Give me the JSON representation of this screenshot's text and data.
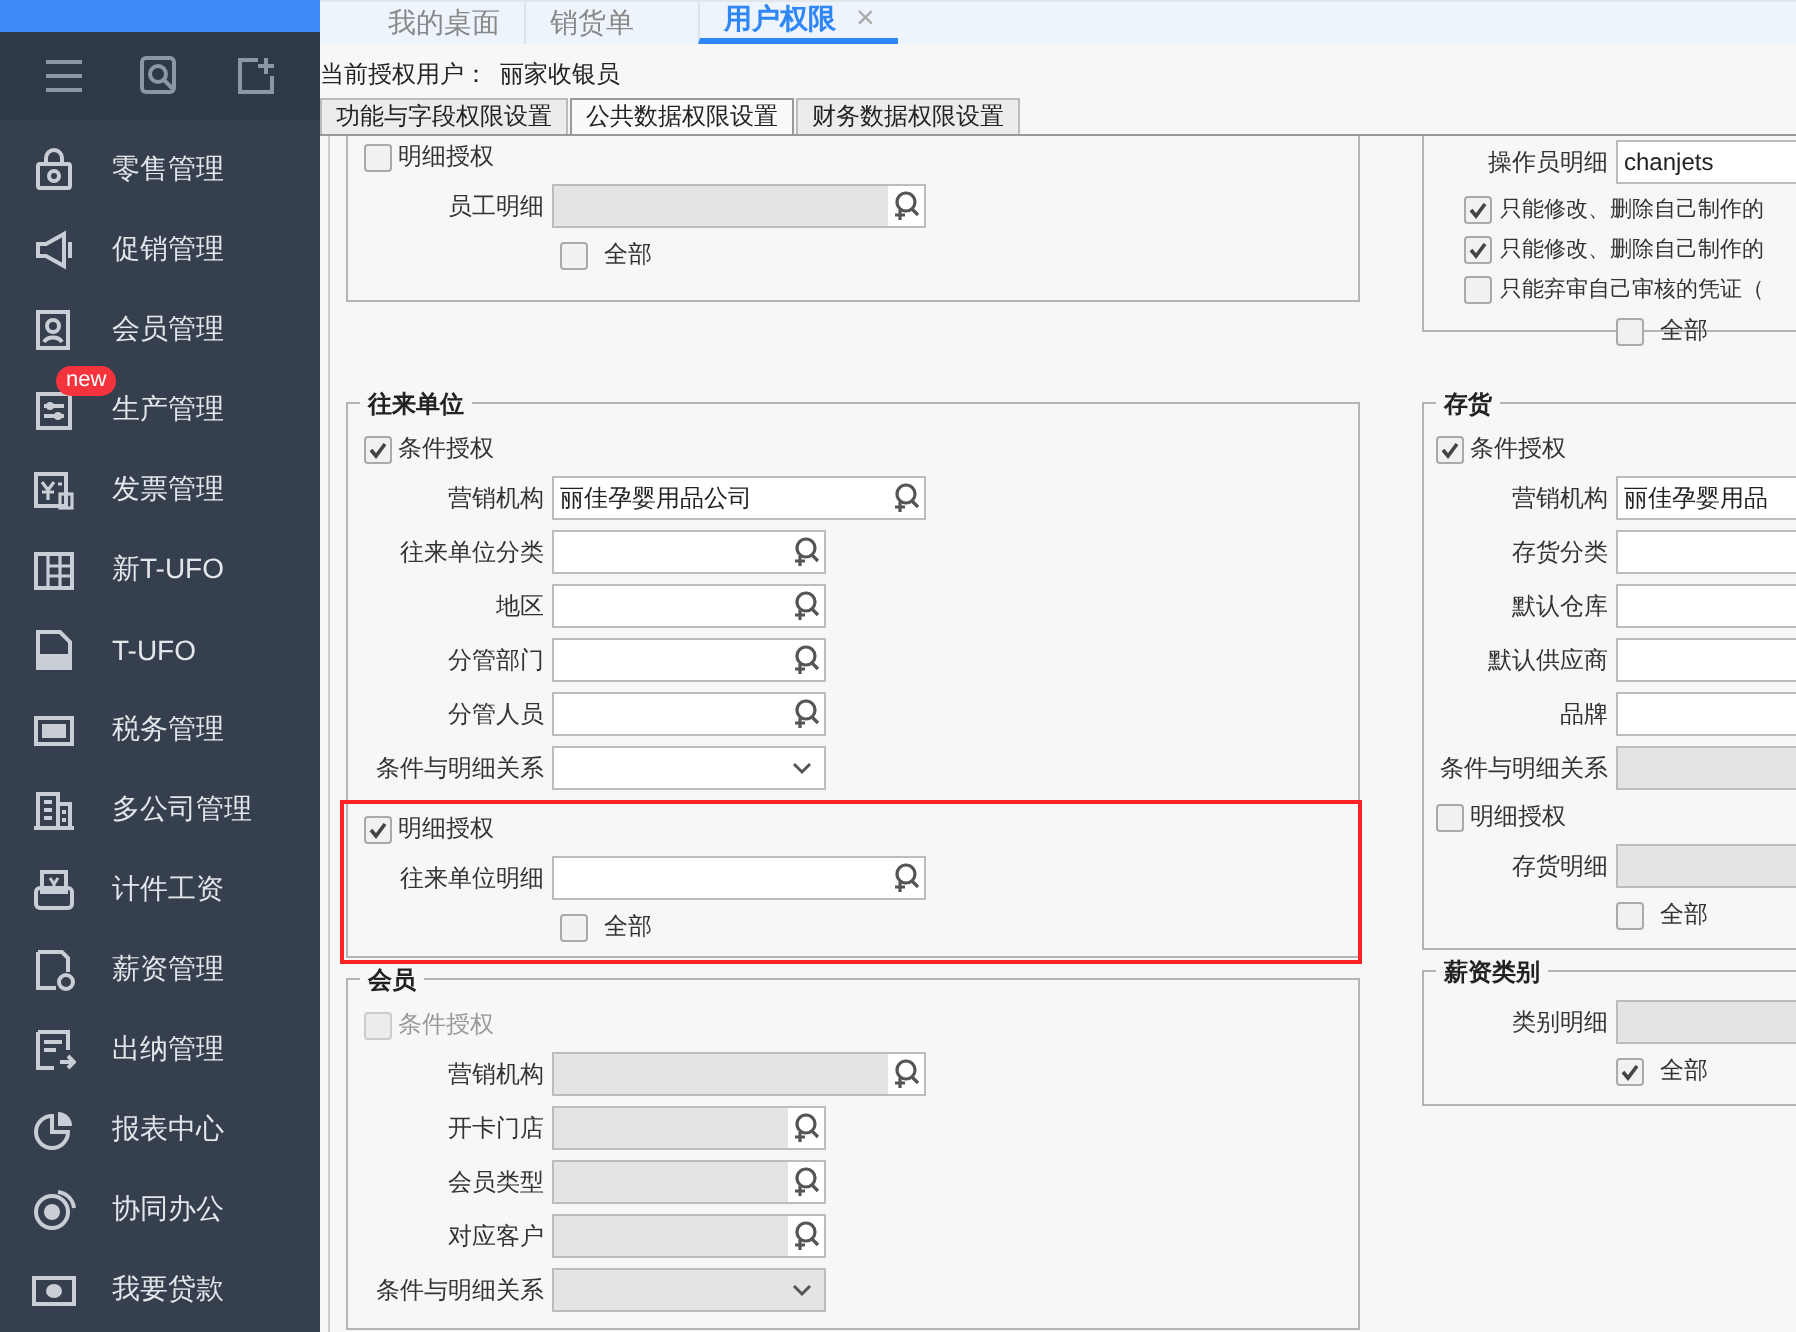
{
  "sidebar": {
    "items": [
      {
        "label": "零售管理"
      },
      {
        "label": "促销管理"
      },
      {
        "label": "会员管理"
      },
      {
        "label": "生产管理",
        "badge": "new"
      },
      {
        "label": "发票管理"
      },
      {
        "label": "新T-UFO"
      },
      {
        "label": "T-UFO"
      },
      {
        "label": "税务管理"
      },
      {
        "label": "多公司管理"
      },
      {
        "label": "计件工资"
      },
      {
        "label": "薪资管理"
      },
      {
        "label": "出纳管理"
      },
      {
        "label": "报表中心"
      },
      {
        "label": "协同办公"
      },
      {
        "label": "我要贷款"
      }
    ]
  },
  "tabs": [
    {
      "label": "我的桌面",
      "selected": false
    },
    {
      "label": "销货单",
      "selected": false
    },
    {
      "label": "用户权限",
      "selected": true,
      "close": "×"
    }
  ],
  "current_user": {
    "label": "当前授权用户：",
    "value": "丽家收银员"
  },
  "subtabs": [
    {
      "label": "功能与字段权限设置",
      "selected": false
    },
    {
      "label": "公共数据权限设置",
      "selected": true
    },
    {
      "label": "财务数据权限设置",
      "selected": false
    }
  ],
  "columns": [
    {
      "panels": [
        {
          "items": [
            {
              "kind": "checkbox",
              "label": "明细授权",
              "checked": false,
              "disabled": false
            },
            {
              "kind": "picker",
              "label": "员工明细",
              "disabled": true
            },
            {
              "kind": "option",
              "label": "全部",
              "checked": false,
              "disabled": false
            }
          ]
        },
        {
          "title": "往来单位",
          "items": [
            {
              "kind": "checkbox",
              "label": "条件授权",
              "checked": true,
              "disabled": false
            },
            {
              "kind": "picker",
              "label": "营销机构",
              "value": "丽佳孕婴用品公司",
              "disabled": false
            },
            {
              "kind": "lookup",
              "label": "往来单位分类",
              "disabled": false
            },
            {
              "kind": "lookup",
              "label": "地区",
              "disabled": false
            },
            {
              "kind": "lookup",
              "label": "分管部门",
              "disabled": false
            },
            {
              "kind": "lookup",
              "label": "分管人员",
              "disabled": false
            },
            {
              "kind": "select",
              "label": "条件与明细关系",
              "disabled": false
            }
          ],
          "highlighted_items": [
            {
              "kind": "checkbox",
              "label": "明细授权",
              "checked": true,
              "disabled": false
            },
            {
              "kind": "picker",
              "label": "往来单位明细",
              "disabled": false
            },
            {
              "kind": "option",
              "label": "全部",
              "checked": false,
              "disabled": false
            }
          ]
        },
        {
          "title": "会员",
          "items": [
            {
              "kind": "checkbox",
              "label": "条件授权",
              "checked": false,
              "disabled": true
            },
            {
              "kind": "picker",
              "label": "营销机构",
              "disabled": true
            },
            {
              "kind": "lookup",
              "label": "开卡门店",
              "disabled": true
            },
            {
              "kind": "lookup",
              "label": "会员类型",
              "disabled": true
            },
            {
              "kind": "lookup",
              "label": "对应客户",
              "disabled": true
            },
            {
              "kind": "select",
              "label": "条件与明细关系",
              "disabled": true
            }
          ]
        }
      ]
    },
    {
      "panels": [
        {
          "items": [
            {
              "kind": "text",
              "label": "操作员明细",
              "value": "chanjets",
              "disabled": false
            },
            {
              "kind": "rule",
              "label": "只能修改、删除自己制作的",
              "checked": true,
              "disabled": false
            },
            {
              "kind": "rule",
              "label": "只能修改、删除自己制作的",
              "checked": true,
              "disabled": false
            },
            {
              "kind": "rule",
              "label": "只能弃审自己审核的凭证（",
              "checked": false,
              "disabled": false
            },
            {
              "kind": "option",
              "label": "全部",
              "checked": false,
              "disabled": false
            }
          ]
        },
        {
          "title": "存货",
          "items": [
            {
              "kind": "checkbox",
              "label": "条件授权",
              "checked": true,
              "disabled": false
            },
            {
              "kind": "text",
              "label": "营销机构",
              "value": "丽佳孕婴用品",
              "disabled": false
            },
            {
              "kind": "text",
              "label": "存货分类",
              "disabled": false
            },
            {
              "kind": "text",
              "label": "默认仓库",
              "disabled": false
            },
            {
              "kind": "text",
              "label": "默认供应商",
              "disabled": false
            },
            {
              "kind": "text",
              "label": "品牌",
              "disabled": false
            },
            {
              "kind": "text",
              "label": "条件与明细关系",
              "disabled": true
            },
            {
              "kind": "checkbox",
              "label": "明细授权",
              "checked": false,
              "disabled": false
            },
            {
              "kind": "text",
              "label": "存货明细",
              "disabled": true
            },
            {
              "kind": "option",
              "label": "全部",
              "checked": false,
              "disabled": false
            }
          ]
        },
        {
          "title": "薪资类别",
          "items": [
            {
              "kind": "text",
              "label": "类别明细",
              "disabled": true
            },
            {
              "kind": "option",
              "label": "全部",
              "checked": true,
              "disabled": false
            }
          ]
        }
      ]
    }
  ]
}
